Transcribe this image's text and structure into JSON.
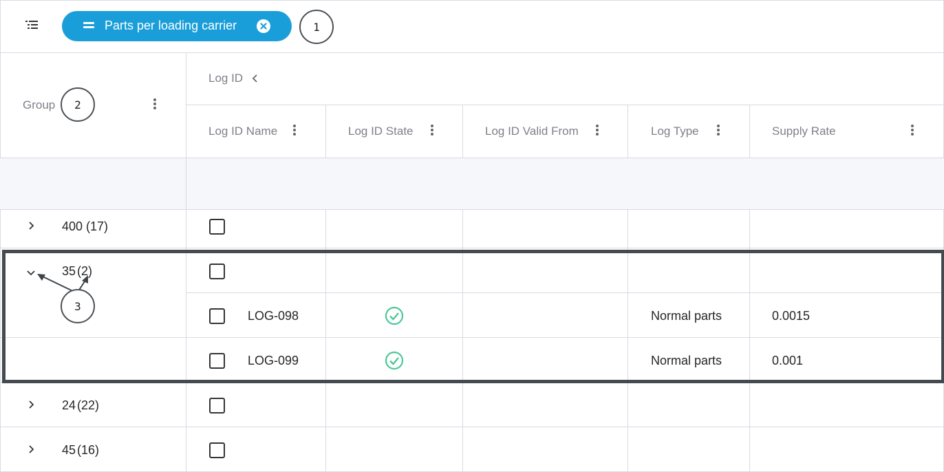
{
  "toolbar": {
    "filter_chip_label": "Parts per loading carrier",
    "callout": "1"
  },
  "header": {
    "group_label": "Group",
    "group_callout": "2",
    "log_id_group": "Log ID",
    "columns": [
      "Log ID Name",
      "Log ID State",
      "Log ID Valid From",
      "Log Type",
      "Supply Rate"
    ]
  },
  "rows": [
    {
      "group": "400",
      "count": "(17)",
      "expanded": false
    },
    {
      "group": "35",
      "count": "(2)",
      "expanded": true
    },
    {
      "name": "LOG-098",
      "state": "valid",
      "log_type": "Normal parts",
      "supply_rate": "0.0015"
    },
    {
      "name": "LOG-099",
      "state": "valid",
      "log_type": "Normal parts",
      "supply_rate": "0.001"
    },
    {
      "group": "24",
      "count": "(22)",
      "expanded": false
    },
    {
      "group": "45",
      "count": "(16)",
      "expanded": false
    }
  ],
  "annotations": {
    "expand_callout": "3"
  },
  "colors": {
    "chip": "#1a9ed9",
    "check": "#4cc79a",
    "highlight_border": "#434b51"
  }
}
